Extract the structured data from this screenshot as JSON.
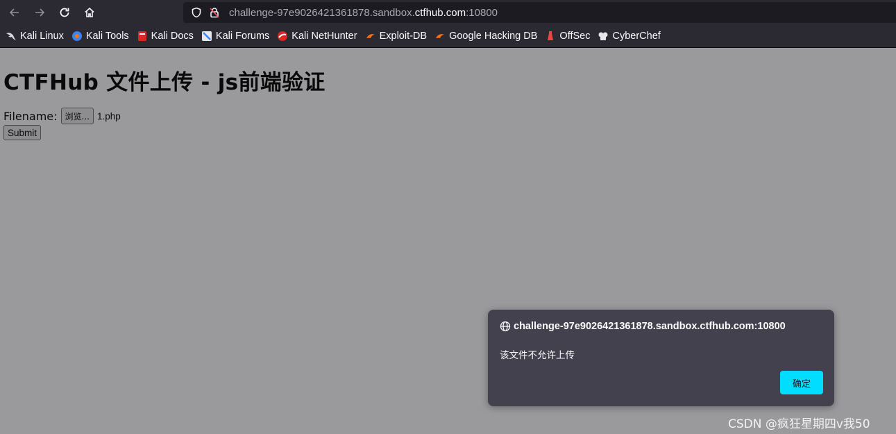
{
  "browser": {
    "url_prefix": "challenge-97e9026421361878.sandbox.",
    "url_domain": "ctfhub.com",
    "url_suffix": ":10800",
    "bookmarks": [
      {
        "label": "Kali Linux",
        "icon": "kali-dragon-icon",
        "color": "#d9d9e0"
      },
      {
        "label": "Kali Tools",
        "icon": "kali-tools-icon",
        "color": "#3b82f6"
      },
      {
        "label": "Kali Docs",
        "icon": "kali-docs-icon",
        "color": "#dc2626"
      },
      {
        "label": "Kali Forums",
        "icon": "kali-forums-icon",
        "color": "#3b82f6"
      },
      {
        "label": "Kali NetHunter",
        "icon": "kali-nethunter-icon",
        "color": "#dc2626"
      },
      {
        "label": "Exploit-DB",
        "icon": "exploit-db-icon",
        "color": "#f97316"
      },
      {
        "label": "Google Hacking DB",
        "icon": "google-hacking-db-icon",
        "color": "#f97316"
      },
      {
        "label": "OffSec",
        "icon": "offsec-icon",
        "color": "#ef4444"
      },
      {
        "label": "CyberChef",
        "icon": "cyberchef-icon",
        "color": "#e5e7eb"
      }
    ]
  },
  "page": {
    "title": "CTFHub 文件上传 - js前端验证",
    "filename_label": "Filename:",
    "browse_label": "浏览...",
    "selected_file": "1.php",
    "submit_label": "Submit"
  },
  "dialog": {
    "origin": "challenge-97e9026421361878.sandbox.ctfhub.com:10800",
    "message": "该文件不允许上传",
    "ok_label": "确定"
  },
  "watermark": "CSDN @疯狂星期四v我50"
}
